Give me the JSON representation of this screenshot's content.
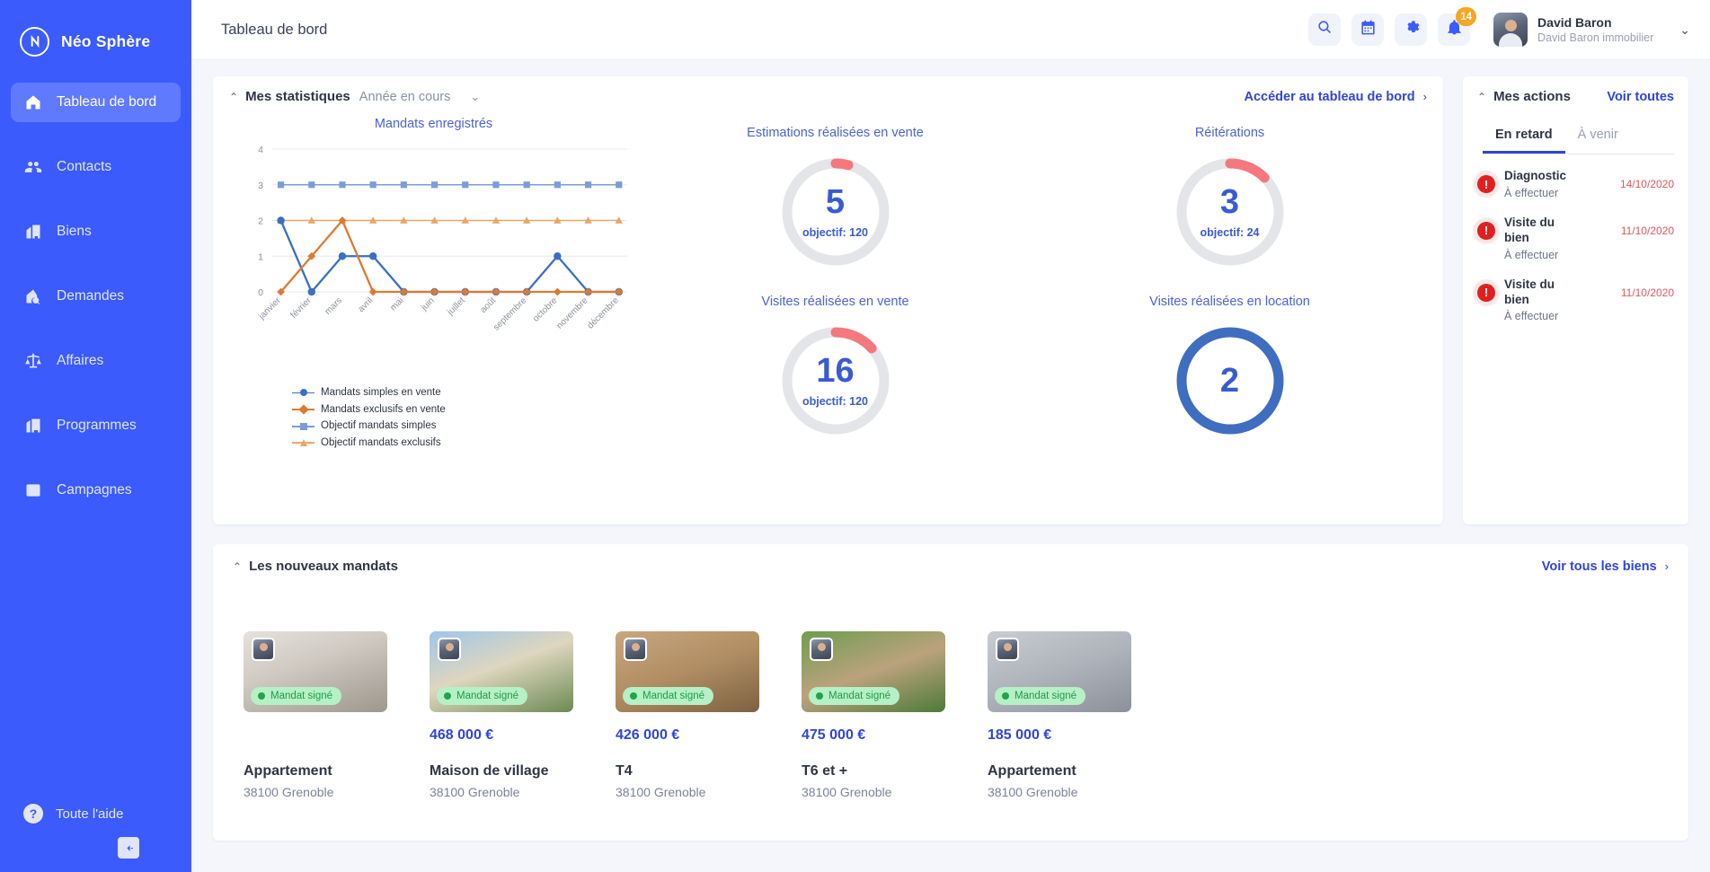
{
  "sidebar": {
    "brand": "Néo Sphère",
    "items": [
      {
        "label": "Tableau de bord",
        "icon": "home-icon",
        "active": true
      },
      {
        "label": "Contacts",
        "icon": "contacts-icon",
        "active": false
      },
      {
        "label": "Biens",
        "icon": "building-icon",
        "active": false
      },
      {
        "label": "Demandes",
        "icon": "home-search-icon",
        "active": false
      },
      {
        "label": "Affaires",
        "icon": "scales-icon",
        "active": false
      },
      {
        "label": "Programmes",
        "icon": "city-icon",
        "active": false
      },
      {
        "label": "Campagnes",
        "icon": "mail-icon",
        "active": false
      }
    ],
    "help_label": "Toute l'aide",
    "help_icon": "question-icon",
    "collapse_icon": "collapse-left-icon"
  },
  "topbar": {
    "title": "Tableau de bord",
    "icons": [
      {
        "name": "search-icon"
      },
      {
        "name": "calendar-icon"
      },
      {
        "name": "gear-icon"
      },
      {
        "name": "bell-icon",
        "badge": "14"
      }
    ],
    "notification_count": "14",
    "user": {
      "name": "David Baron",
      "org": "David Baron immobilier",
      "chevron": "⌄"
    }
  },
  "stats": {
    "caret": "⌃",
    "title": "Mes statistiques",
    "period": "Année en cours",
    "dropdown_caret": "⌄",
    "link": "Accéder au tableau de bord",
    "link_arrow": "›",
    "gauges": [
      {
        "title": "Estimations réalisées en vente",
        "value": "5",
        "objective_label": "objectif: 120",
        "percent": 4.2,
        "color": "#f4787e"
      },
      {
        "title": "Réitérations",
        "value": "3",
        "objective_label": "objectif: 24",
        "percent": 12.5,
        "color": "#f4787e"
      },
      {
        "title": "Visites réalisées en vente",
        "value": "16",
        "objective_label": "objectif: 120",
        "percent": 13.3,
        "color": "#f4787e"
      },
      {
        "title": "Visites réalisées en location",
        "value": "2",
        "objective_label": "",
        "percent": 100,
        "color": "#3f6ec0"
      }
    ]
  },
  "chart_data": {
    "type": "line",
    "title": "Mandats enregistrés",
    "xlabel": "",
    "ylabel": "",
    "ylim": [
      0,
      4
    ],
    "yticks": [
      0,
      1,
      2,
      3,
      4
    ],
    "grid": true,
    "legend_position": "bottom",
    "categories": [
      "janvier",
      "février",
      "mars",
      "avril",
      "mai",
      "juin",
      "juillet",
      "août",
      "septembre",
      "octobre",
      "novembre",
      "décembre"
    ],
    "series": [
      {
        "name": "Mandats simples en vente",
        "color": "#3b6fc4",
        "marker": "circle",
        "values": [
          2,
          0,
          1,
          1,
          0,
          0,
          0,
          0,
          0,
          1,
          0,
          0
        ]
      },
      {
        "name": "Mandats exclusifs en vente",
        "color": "#dd7a32",
        "marker": "diamond",
        "values": [
          0,
          1,
          2,
          0,
          0,
          0,
          0,
          0,
          0,
          0,
          0,
          0
        ]
      },
      {
        "name": "Objectif mandats simples",
        "color": "#7d9dd4",
        "marker": "square",
        "values": [
          3,
          3,
          3,
          3,
          3,
          3,
          3,
          3,
          3,
          3,
          3,
          3
        ]
      },
      {
        "name": "Objectif mandats exclusifs",
        "color": "#e8a76c",
        "marker": "triangle",
        "values": [
          2,
          2,
          2,
          2,
          2,
          2,
          2,
          2,
          2,
          2,
          2,
          2
        ]
      }
    ]
  },
  "actions": {
    "caret": "⌃",
    "title": "Mes actions",
    "link": "Voir toutes",
    "tabs": [
      {
        "label": "En retard",
        "active": true
      },
      {
        "label": "À venir",
        "active": false
      }
    ],
    "items": [
      {
        "icon": "alert-icon",
        "title": "Diagnostic",
        "status": "À effectuer",
        "date": "14/10/2020"
      },
      {
        "icon": "alert-icon",
        "title": "Visite du bien",
        "status": "À effectuer",
        "date": "11/10/2020"
      },
      {
        "icon": "alert-icon",
        "title": "Visite du bien",
        "status": "À effectuer",
        "date": "11/10/2020"
      }
    ]
  },
  "mandats": {
    "caret": "⌃",
    "title": "Les nouveaux mandats",
    "link": "Voir tous les biens",
    "link_arrow": "›",
    "properties": [
      {
        "price": "",
        "type": "Appartement",
        "location": "38100 Grenoble",
        "badge": "Mandat signé",
        "img": "interior-living-room"
      },
      {
        "price": "468 000 €",
        "type": "Maison de village",
        "location": "38100 Grenoble",
        "badge": "Mandat signé",
        "img": "village-house"
      },
      {
        "price": "426 000 €",
        "type": "T4",
        "location": "38100 Grenoble",
        "badge": "Mandat signé",
        "img": "bedroom-interior"
      },
      {
        "price": "475 000 €",
        "type": "T6 et +",
        "location": "38100 Grenoble",
        "badge": "Mandat signé",
        "img": "manor-garden"
      },
      {
        "price": "185 000 €",
        "type": "Appartement",
        "location": "38100 Grenoble",
        "badge": "Mandat signé",
        "img": "apartment-block"
      }
    ]
  },
  "colors": {
    "brand_blue": "#3b5bfd",
    "accent_link": "#2f45d8",
    "gauge_red": "#f4787e",
    "gauge_track": "#e3e5e9",
    "gauge_blue": "#3f6ec0",
    "badge_orange": "#f5a623",
    "alert_red": "#e02020",
    "green": "#23a34e"
  }
}
